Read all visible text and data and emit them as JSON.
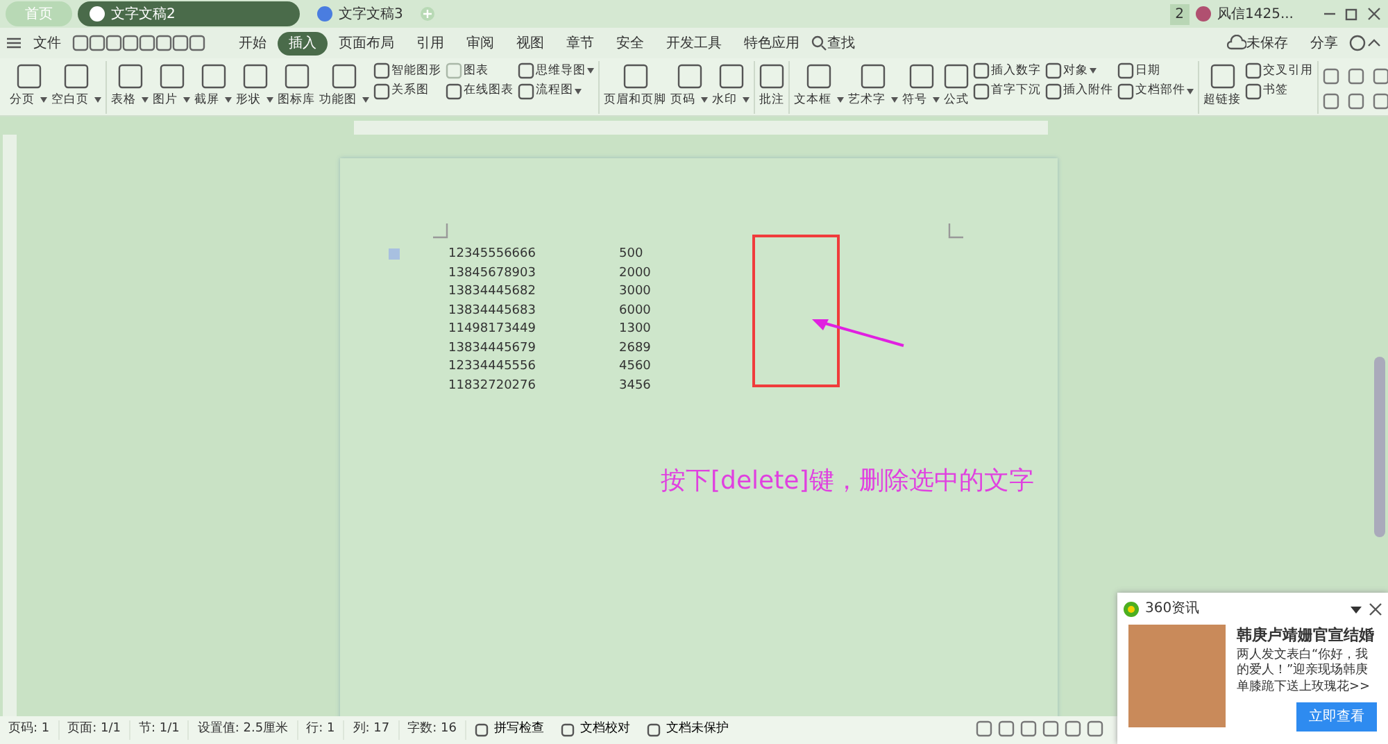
{
  "tabs": [
    {
      "label": "首页",
      "kind": "home",
      "selected": false
    },
    {
      "label": "文字文稿2",
      "kind": "doc",
      "selected": true
    },
    {
      "label": "文字文稿3",
      "kind": "doc",
      "selected": false
    }
  ],
  "title_bar": {
    "badge": "2",
    "user": "风信1425..."
  },
  "menu": {
    "file": "文件",
    "items": [
      {
        "label": "开始",
        "selected": false
      },
      {
        "label": "插入",
        "selected": true
      },
      {
        "label": "页面布局",
        "selected": false
      },
      {
        "label": "引用",
        "selected": false
      },
      {
        "label": "审阅",
        "selected": false
      },
      {
        "label": "视图",
        "selected": false
      },
      {
        "label": "章节",
        "selected": false
      },
      {
        "label": "安全",
        "selected": false
      },
      {
        "label": "开发工具",
        "selected": false
      },
      {
        "label": "特色应用",
        "selected": false
      }
    ],
    "search": "查找",
    "save_state": "未保存",
    "share": "分享"
  },
  "ribbon": [
    [
      {
        "kind": "large",
        "label": "分页",
        "dropdown": true
      },
      {
        "kind": "large",
        "label": "空白页",
        "dropdown": true
      }
    ],
    [
      {
        "kind": "large",
        "label": "表格",
        "dropdown": true
      },
      {
        "kind": "large",
        "label": "图片",
        "dropdown": true
      },
      {
        "kind": "large",
        "label": "截屏",
        "dropdown": true
      },
      {
        "kind": "large",
        "label": "形状",
        "dropdown": true
      },
      {
        "kind": "large",
        "label": "图标库",
        "dropdown": false
      },
      {
        "kind": "large",
        "label": "功能图",
        "dropdown": true
      },
      {
        "kind": "stack",
        "items": [
          {
            "label": "智能图形",
            "dropdown": false,
            "disabled": false
          },
          {
            "label": "关系图",
            "dropdown": false,
            "disabled": false
          }
        ]
      },
      {
        "kind": "stack",
        "items": [
          {
            "label": "图表",
            "dropdown": false,
            "disabled": true
          },
          {
            "label": "在线图表",
            "dropdown": false,
            "disabled": false
          }
        ]
      },
      {
        "kind": "stack",
        "items": [
          {
            "label": "思维导图",
            "dropdown": true,
            "disabled": false
          },
          {
            "label": "流程图",
            "dropdown": true,
            "disabled": false
          }
        ]
      }
    ],
    [
      {
        "kind": "large",
        "label": "页眉和页脚",
        "dropdown": false
      },
      {
        "kind": "large",
        "label": "页码",
        "dropdown": true
      },
      {
        "kind": "large",
        "label": "水印",
        "dropdown": true
      }
    ],
    [
      {
        "kind": "large",
        "label": "批注",
        "dropdown": false
      }
    ],
    [
      {
        "kind": "large",
        "label": "文本框",
        "dropdown": true
      },
      {
        "kind": "large",
        "label": "艺术字",
        "dropdown": true
      },
      {
        "kind": "large",
        "label": "符号",
        "dropdown": true
      },
      {
        "kind": "large",
        "label": "公式",
        "dropdown": false
      },
      {
        "kind": "stack",
        "items": [
          {
            "label": "插入数字",
            "dropdown": false,
            "disabled": false
          },
          {
            "label": "首字下沉",
            "dropdown": false,
            "disabled": false
          }
        ]
      },
      {
        "kind": "stack",
        "items": [
          {
            "label": "对象",
            "dropdown": true,
            "disabled": false
          },
          {
            "label": "插入附件",
            "dropdown": false,
            "disabled": false
          }
        ]
      },
      {
        "kind": "stack",
        "items": [
          {
            "label": "日期",
            "dropdown": false,
            "disabled": false
          },
          {
            "label": "文档部件",
            "dropdown": true,
            "disabled": false
          }
        ]
      }
    ],
    [
      {
        "kind": "large",
        "label": "超链接",
        "dropdown": false
      },
      {
        "kind": "stack",
        "items": [
          {
            "label": "交叉引用",
            "dropdown": false,
            "disabled": false
          },
          {
            "label": "书签",
            "dropdown": false,
            "disabled": false
          }
        ]
      }
    ],
    [
      {
        "kind": "grid"
      }
    ]
  ],
  "document": {
    "rows": [
      {
        "phone": "12345556666",
        "amount": "500"
      },
      {
        "phone": "13845678903",
        "amount": "2000"
      },
      {
        "phone": "13834445682",
        "amount": "3000"
      },
      {
        "phone": "13834445683",
        "amount": "6000"
      },
      {
        "phone": "11498173449",
        "amount": "1300"
      },
      {
        "phone": "13834445679",
        "amount": "2689"
      },
      {
        "phone": "12334445556",
        "amount": "4560"
      },
      {
        "phone": "11832720276",
        "amount": "3456"
      }
    ],
    "annotation": "按下[delete]键，删除选中的文字"
  },
  "status_bar": [
    "页码: 1",
    "页面: 1/1",
    "节: 1/1",
    "设置值: 2.5厘米",
    "行: 1",
    "列: 17",
    "字数: 16"
  ],
  "status_tools": [
    "拼写检查",
    "文档校对",
    "文档未保护"
  ],
  "ad": {
    "source": "360资讯",
    "headline": "韩庚卢靖姗官宣结婚",
    "body": "两人发文表白“你好，我的爱人！”迎亲现场韩庚单膝跪下送上玫瑰花>>",
    "button": "立即查看"
  }
}
